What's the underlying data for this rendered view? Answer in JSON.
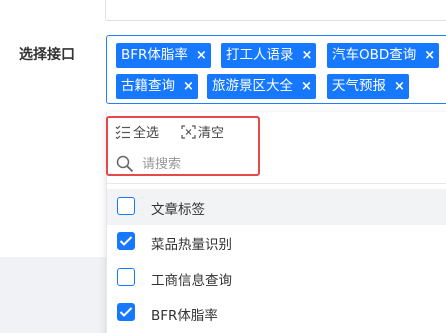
{
  "form": {
    "label": "选择接口"
  },
  "select": {
    "tags": [
      {
        "label": "BFR体脂率"
      },
      {
        "label": "打工人语录"
      },
      {
        "label": "汽车OBD查询"
      },
      {
        "label": "古籍查询"
      },
      {
        "label": "旅游景区大全"
      },
      {
        "label": "天气预报"
      }
    ],
    "close_glyph": "×"
  },
  "dropdown": {
    "select_all": "全选",
    "clear": "清空",
    "search_placeholder": "请搜索",
    "options": [
      {
        "label": "文章标签",
        "checked": false
      },
      {
        "label": "菜品热量识别",
        "checked": true
      },
      {
        "label": "工商信息查询",
        "checked": false
      },
      {
        "label": "BFR体脂率",
        "checked": true
      }
    ]
  },
  "colors": {
    "accent": "#1677ff",
    "highlight": "#e5484d"
  }
}
